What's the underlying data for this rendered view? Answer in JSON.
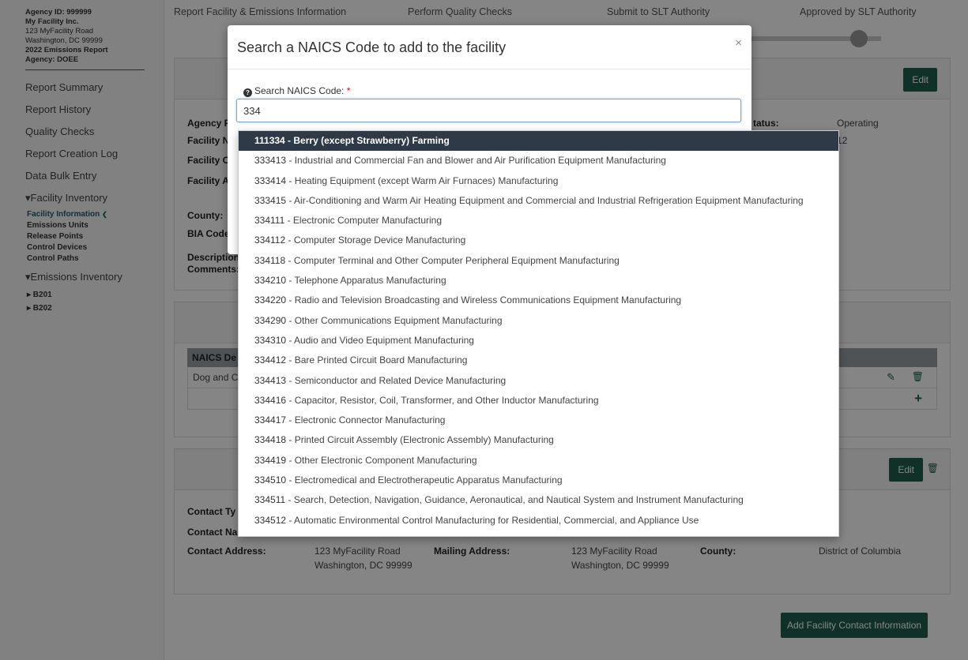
{
  "agency": {
    "id": "Agency ID: 999999",
    "facility": "My Facility Inc.",
    "address1": "123 MyFacility Road",
    "address2": "Washington, DC 99999",
    "report": "2022 Emissions Report",
    "agency": "Agency: DOEE"
  },
  "sidebar": {
    "items": [
      "Report Summary",
      "Report History",
      "Quality Checks",
      "Report Creation Log",
      "Data Bulk Entry"
    ],
    "facility_inventory": "▾Facility Inventory",
    "facility_sub": [
      "Facility Information",
      "Emissions Units",
      "Release Points",
      "Control Devices",
      "Control Paths"
    ],
    "active_marker": "❮",
    "emissions_inventory": "▾Emissions Inventory",
    "emissions_sub": [
      "▸ B201",
      "▸ B202"
    ]
  },
  "steps": [
    "Report Facility & Emissions Information",
    "Perform Quality Checks",
    "Submit to SLT Authority",
    "Approved by SLT Authority"
  ],
  "facility_panel": {
    "edit_label": "Edit",
    "labels": [
      "Agency F",
      "Facility N",
      "Facility C",
      "Facility A",
      "County:",
      "BIA Code",
      "Description",
      "Comments:"
    ],
    "status_label": "tatus:",
    "status_value": "Operating",
    "status_value2": "12"
  },
  "naics_panel": {
    "col_header": "NAICS De",
    "row_value": "Dog and C"
  },
  "contact_panel": {
    "edit_label": "Edit",
    "contact_type": "Contact Ty",
    "contact_name": "Contact Na",
    "address_label": "Contact Address:",
    "address_line1": "123 MyFacility Road",
    "address_line2": "Washington, DC 99999",
    "mailing_label": "Mailing Address:",
    "mailing_line1": "123 MyFacility Road",
    "mailing_line2": "Washington, DC 99999",
    "county_label": "County:",
    "county_value": "District of Columbia",
    "add_contact_label": "Add Facility Contact Information"
  },
  "modal": {
    "title": "Search a NAICS Code to add to the facility",
    "close": "×",
    "search_label": "Search NAICS Code:",
    "required": "*",
    "search_value": "334"
  },
  "dropdown": {
    "items": [
      {
        "code": "111334",
        "desc": " - Berry (except Strawberry) Farming",
        "active": true
      },
      {
        "code": "333413",
        "desc": " - Industrial and Commercial Fan and Blower and Air Purification Equipment Manufacturing"
      },
      {
        "code": "333414",
        "desc": " - Heating Equipment (except Warm Air Furnaces) Manufacturing"
      },
      {
        "code": "333415",
        "desc": " - Air-Conditioning and Warm Air Heating Equipment and Commercial and Industrial Refrigeration Equipment Manufacturing"
      },
      {
        "code": "334111",
        "desc": " - Electronic Computer Manufacturing"
      },
      {
        "code": "334112",
        "desc": " - Computer Storage Device Manufacturing"
      },
      {
        "code": "334118",
        "desc": " - Computer Terminal and Other Computer Peripheral Equipment Manufacturing"
      },
      {
        "code": "334210",
        "desc": " - Telephone Apparatus Manufacturing"
      },
      {
        "code": "334220",
        "desc": " - Radio and Television Broadcasting and Wireless Communications Equipment Manufacturing"
      },
      {
        "code": "334290",
        "desc": " - Other Communications Equipment Manufacturing"
      },
      {
        "code": "334310",
        "desc": " - Audio and Video Equipment Manufacturing"
      },
      {
        "code": "334412",
        "desc": " - Bare Printed Circuit Board Manufacturing"
      },
      {
        "code": "334413",
        "desc": " - Semiconductor and Related Device Manufacturing"
      },
      {
        "code": "334416",
        "desc": " - Capacitor, Resistor, Coil, Transformer, and Other Inductor Manufacturing"
      },
      {
        "code": "334417",
        "desc": " - Electronic Connector Manufacturing"
      },
      {
        "code": "334418",
        "desc": " - Printed Circuit Assembly (Electronic Assembly) Manufacturing"
      },
      {
        "code": "334419",
        "desc": " - Other Electronic Component Manufacturing"
      },
      {
        "code": "334510",
        "desc": " - Electromedical and Electrotherapeutic Apparatus Manufacturing"
      },
      {
        "code": "334511",
        "desc": " - Search, Detection, Navigation, Guidance, Aeronautical, and Nautical System and Instrument Manufacturing"
      },
      {
        "code": "334512",
        "desc": " - Automatic Environmental Control Manufacturing for Residential, Commercial, and Appliance Use"
      }
    ]
  },
  "colors": {
    "accent_green": "#1d5e4b",
    "dropdown_active": "#2e3a47",
    "required": "#dd0000"
  }
}
